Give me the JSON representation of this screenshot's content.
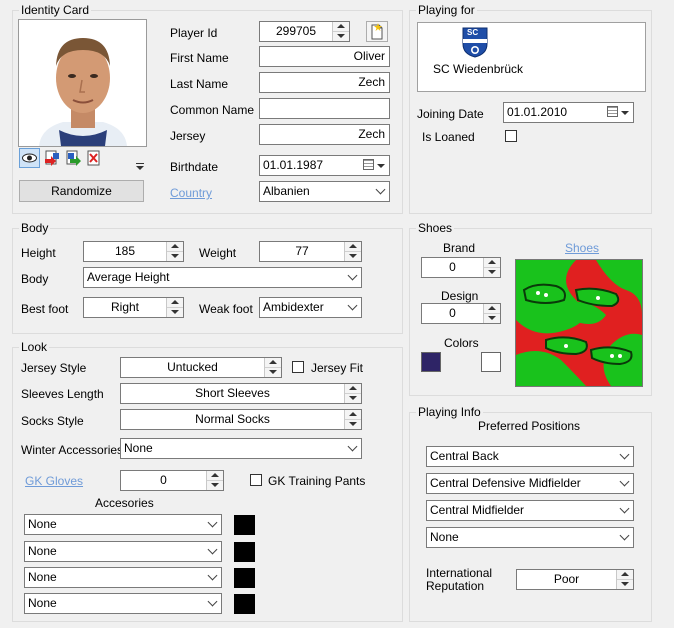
{
  "identity": {
    "title": "Identity Card",
    "randomize_label": "Randomize",
    "player_id_label": "Player Id",
    "player_id": "299705",
    "first_name_label": "First Name",
    "first_name": "Oliver",
    "last_name_label": "Last Name",
    "last_name": "Zech",
    "common_name_label": "Common Name",
    "common_name": "",
    "jersey_label": "Jersey",
    "jersey": "Zech",
    "birthdate_label": "Birthdate",
    "birthdate": "01.01.1987",
    "country_label": "Country",
    "country": "Albanien"
  },
  "playing_for": {
    "title": "Playing for",
    "club_name": "SC Wiedenbrück",
    "club_badge_text": "SC",
    "joining_date_label": "Joining Date",
    "joining_date": "01.01.2010",
    "is_loaned_label": "Is Loaned"
  },
  "body": {
    "title": "Body",
    "height_label": "Height",
    "height": "185",
    "weight_label": "Weight",
    "weight": "77",
    "body_label": "Body",
    "body_type": "Average Height",
    "best_foot_label": "Best foot",
    "best_foot": "Right",
    "weak_foot_label": "Weak foot",
    "weak_foot": "Ambidexter"
  },
  "shoes": {
    "title": "Shoes",
    "brand_label": "Brand",
    "brand": "0",
    "design_label": "Design",
    "design": "0",
    "colors_label": "Colors",
    "shoes_link": "Shoes",
    "color1": "#2e2466",
    "color2": "#ffffff"
  },
  "look": {
    "title": "Look",
    "jersey_style_label": "Jersey Style",
    "jersey_style": "Untucked",
    "jersey_fit_label": "Jersey Fit",
    "sleeves_label": "Sleeves Length",
    "sleeves": "Short Sleeves",
    "socks_label": "Socks Style",
    "socks": "Normal Socks",
    "winter_label": "Winter Accessories",
    "winter": "None",
    "gk_gloves_label": "GK Gloves",
    "gk_gloves": "0",
    "gk_pants_label": "GK Training Pants",
    "accessories_label": "Accesories",
    "accessories": [
      "None",
      "None",
      "None",
      "None"
    ]
  },
  "playing_info": {
    "title": "Playing Info",
    "preferred_label": "Preferred Positions",
    "positions": [
      "Central Back",
      "Central Defensive Midfielder",
      "Central Midfielder",
      "None"
    ],
    "reputation_label_1": "International",
    "reputation_label_2": "Reputation",
    "reputation": "Poor"
  }
}
